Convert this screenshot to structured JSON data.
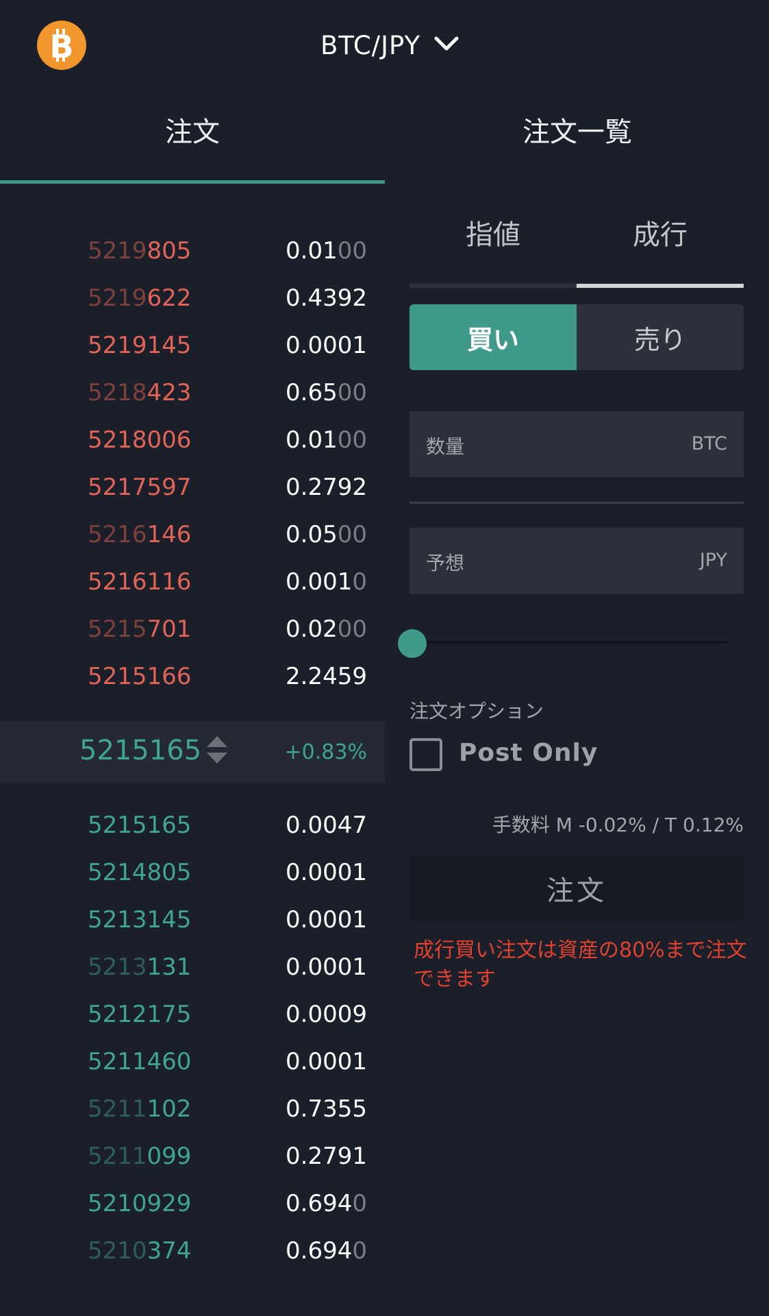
{
  "header": {
    "pair": "BTC/JPY",
    "logo_icon": "bitcoin-icon",
    "dropdown_icon": "chevron-down-icon"
  },
  "tabs": [
    {
      "label": "注文",
      "active": true
    },
    {
      "label": "注文一覧",
      "active": false
    }
  ],
  "orderbook": {
    "asks": [
      {
        "price_dim": "5219",
        "price_main": "805",
        "qty_main": "0.01",
        "qty_dim": "00"
      },
      {
        "price_dim": "5219",
        "price_main": "622",
        "qty_main": "0.4392",
        "qty_dim": ""
      },
      {
        "price_dim": "",
        "price_main": "5219145",
        "qty_main": "0.0001",
        "qty_dim": ""
      },
      {
        "price_dim": "5218",
        "price_main": "423",
        "qty_main": "0.65",
        "qty_dim": "00"
      },
      {
        "price_dim": "",
        "price_main": "5218006",
        "qty_main": "0.01",
        "qty_dim": "00"
      },
      {
        "price_dim": "",
        "price_main": "5217597",
        "qty_main": "0.2792",
        "qty_dim": ""
      },
      {
        "price_dim": "5216",
        "price_main": "146",
        "qty_main": "0.05",
        "qty_dim": "00"
      },
      {
        "price_dim": "",
        "price_main": "5216116",
        "qty_main": "0.001",
        "qty_dim": "0"
      },
      {
        "price_dim": "5215",
        "price_main": "701",
        "qty_main": "0.02",
        "qty_dim": "00"
      },
      {
        "price_dim": "",
        "price_main": "5215166",
        "qty_main": "2.2459",
        "qty_dim": ""
      }
    ],
    "mid": {
      "price": "5215165",
      "change": "+0.83%"
    },
    "bids": [
      {
        "price_dim": "",
        "price_main": "5215165",
        "qty_main": "0.0047",
        "qty_dim": ""
      },
      {
        "price_dim": "",
        "price_main": "5214805",
        "qty_main": "0.0001",
        "qty_dim": ""
      },
      {
        "price_dim": "",
        "price_main": "5213145",
        "qty_main": "0.0001",
        "qty_dim": ""
      },
      {
        "price_dim": "5213",
        "price_main": "131",
        "qty_main": "0.0001",
        "qty_dim": ""
      },
      {
        "price_dim": "",
        "price_main": "5212175",
        "qty_main": "0.0009",
        "qty_dim": ""
      },
      {
        "price_dim": "",
        "price_main": "5211460",
        "qty_main": "0.0001",
        "qty_dim": ""
      },
      {
        "price_dim": "5211",
        "price_main": "102",
        "qty_main": "0.7355",
        "qty_dim": ""
      },
      {
        "price_dim": "5211",
        "price_main": "099",
        "qty_main": "0.2791",
        "qty_dim": ""
      },
      {
        "price_dim": "",
        "price_main": "5210929",
        "qty_main": "0.694",
        "qty_dim": "0"
      },
      {
        "price_dim": "5210",
        "price_main": "374",
        "qty_main": "0.694",
        "qty_dim": "0"
      }
    ]
  },
  "order_form": {
    "type_tabs": [
      {
        "label": "指値",
        "active": false
      },
      {
        "label": "成行",
        "active": true
      }
    ],
    "side": {
      "buy": "買い",
      "sell": "売り",
      "selected": "buy"
    },
    "quantity": {
      "label": "数量",
      "unit": "BTC"
    },
    "estimate": {
      "label": "予想",
      "unit": "JPY"
    },
    "slider_value_percent": 0,
    "options_label": "注文オプション",
    "post_only": {
      "label": "Post Only",
      "checked": false
    },
    "fee": "手数料 M -0.02% / T 0.12%",
    "submit_label": "注文",
    "warning": "成行買い注文は資産の80%まで注文できます"
  },
  "colors": {
    "accent": "#3f9a89",
    "ask": "#e26357",
    "bid": "#3fa592",
    "warning": "#e2412f",
    "background": "#1b1f29"
  }
}
